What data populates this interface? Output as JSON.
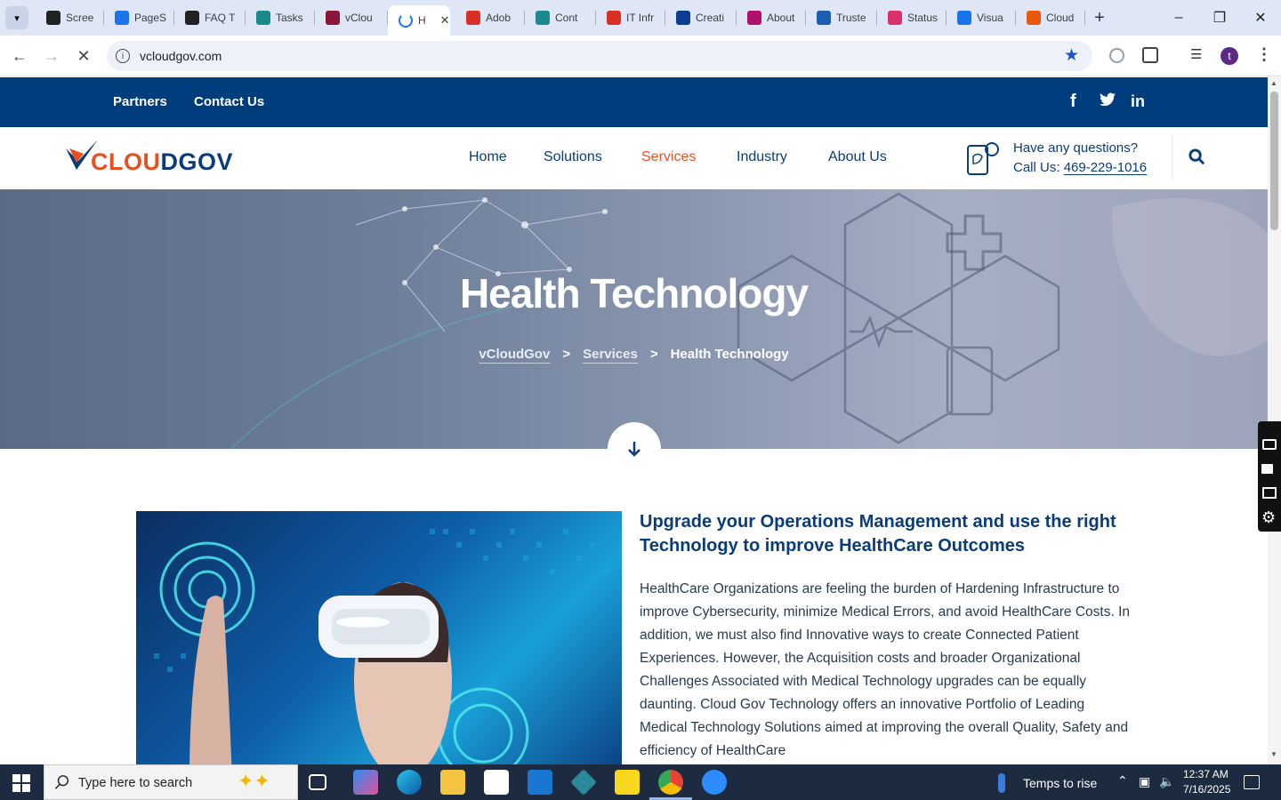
{
  "browser": {
    "tabs": [
      {
        "label": "Scree",
        "icon": "screencast-icon",
        "color": "#222222"
      },
      {
        "label": "PageS",
        "icon": "pagespeed-icon",
        "color": "#1a73e8"
      },
      {
        "label": "FAQ T",
        "icon": "faq-icon",
        "color": "#222222"
      },
      {
        "label": "Tasks",
        "icon": "tasks-icon",
        "color": "#1c8a8a"
      },
      {
        "label": "vClou",
        "icon": "vcloud-icon",
        "color": "#8a1538"
      },
      {
        "label": "H",
        "icon": "loading-icon",
        "color": "#1a73e8",
        "active": true
      },
      {
        "label": "Adob",
        "icon": "adobe-icon",
        "color": "#d93025"
      },
      {
        "label": "Cont",
        "icon": "contact-icon",
        "color": "#1c8a8a"
      },
      {
        "label": "IT Infr",
        "icon": "it-icon",
        "color": "#d93025"
      },
      {
        "label": "Creati",
        "icon": "confluence-icon",
        "color": "#0c3d91"
      },
      {
        "label": "About",
        "icon": "about-icon",
        "color": "#b0126b"
      },
      {
        "label": "Truste",
        "icon": "trust-icon",
        "color": "#1a5fb4"
      },
      {
        "label": "Status",
        "icon": "status-icon",
        "color": "#d6336c"
      },
      {
        "label": "Visua",
        "icon": "visual-icon",
        "color": "#1a73e8"
      },
      {
        "label": "Cloud",
        "icon": "cloud-icon",
        "color": "#e8590c"
      }
    ],
    "url": "vcloudgov.com",
    "profile_initial": "t"
  },
  "site": {
    "topbar": {
      "partners": "Partners",
      "contact": "Contact Us",
      "social": [
        "f",
        "t",
        "in"
      ]
    },
    "logo_text": "CLOUDGOV",
    "nav": [
      "Home",
      "Solutions",
      "Services",
      "Industry",
      "About Us"
    ],
    "active_nav": "Services",
    "question": "Have any questions?",
    "call_label": "Call Us:",
    "phone": "469-229-1016",
    "accent": "#e8501f",
    "brand": "#003d7c"
  },
  "hero": {
    "title": "Health Technology",
    "crumbs": [
      "vCloudGov",
      "Services",
      "Health Technology"
    ],
    "sep": ">"
  },
  "content": {
    "headline": "Upgrade your Operations Management and use the right Technology to improve HealthCare Outcomes",
    "body": "HealthCare Organizations are feeling the burden of Hardening Infrastructure to improve Cybersecurity, minimize Medical Errors, and avoid HealthCare Costs. In addition, we must also find Innovative ways to create Connected Patient Experiences. However, the Acquisition costs and broader Organizational Challenges Associated with Medical Technology upgrades can be equally daunting. Cloud Gov Technology offers an innovative Portfolio of Leading Medical Technology Solutions aimed at improving the overall Quality, Safety and efficiency of HealthCare"
  },
  "taskbar": {
    "search_placeholder": "Type here to search",
    "weather": "Temps to rise",
    "time": "12:37 AM",
    "date": "7/16/2025"
  }
}
